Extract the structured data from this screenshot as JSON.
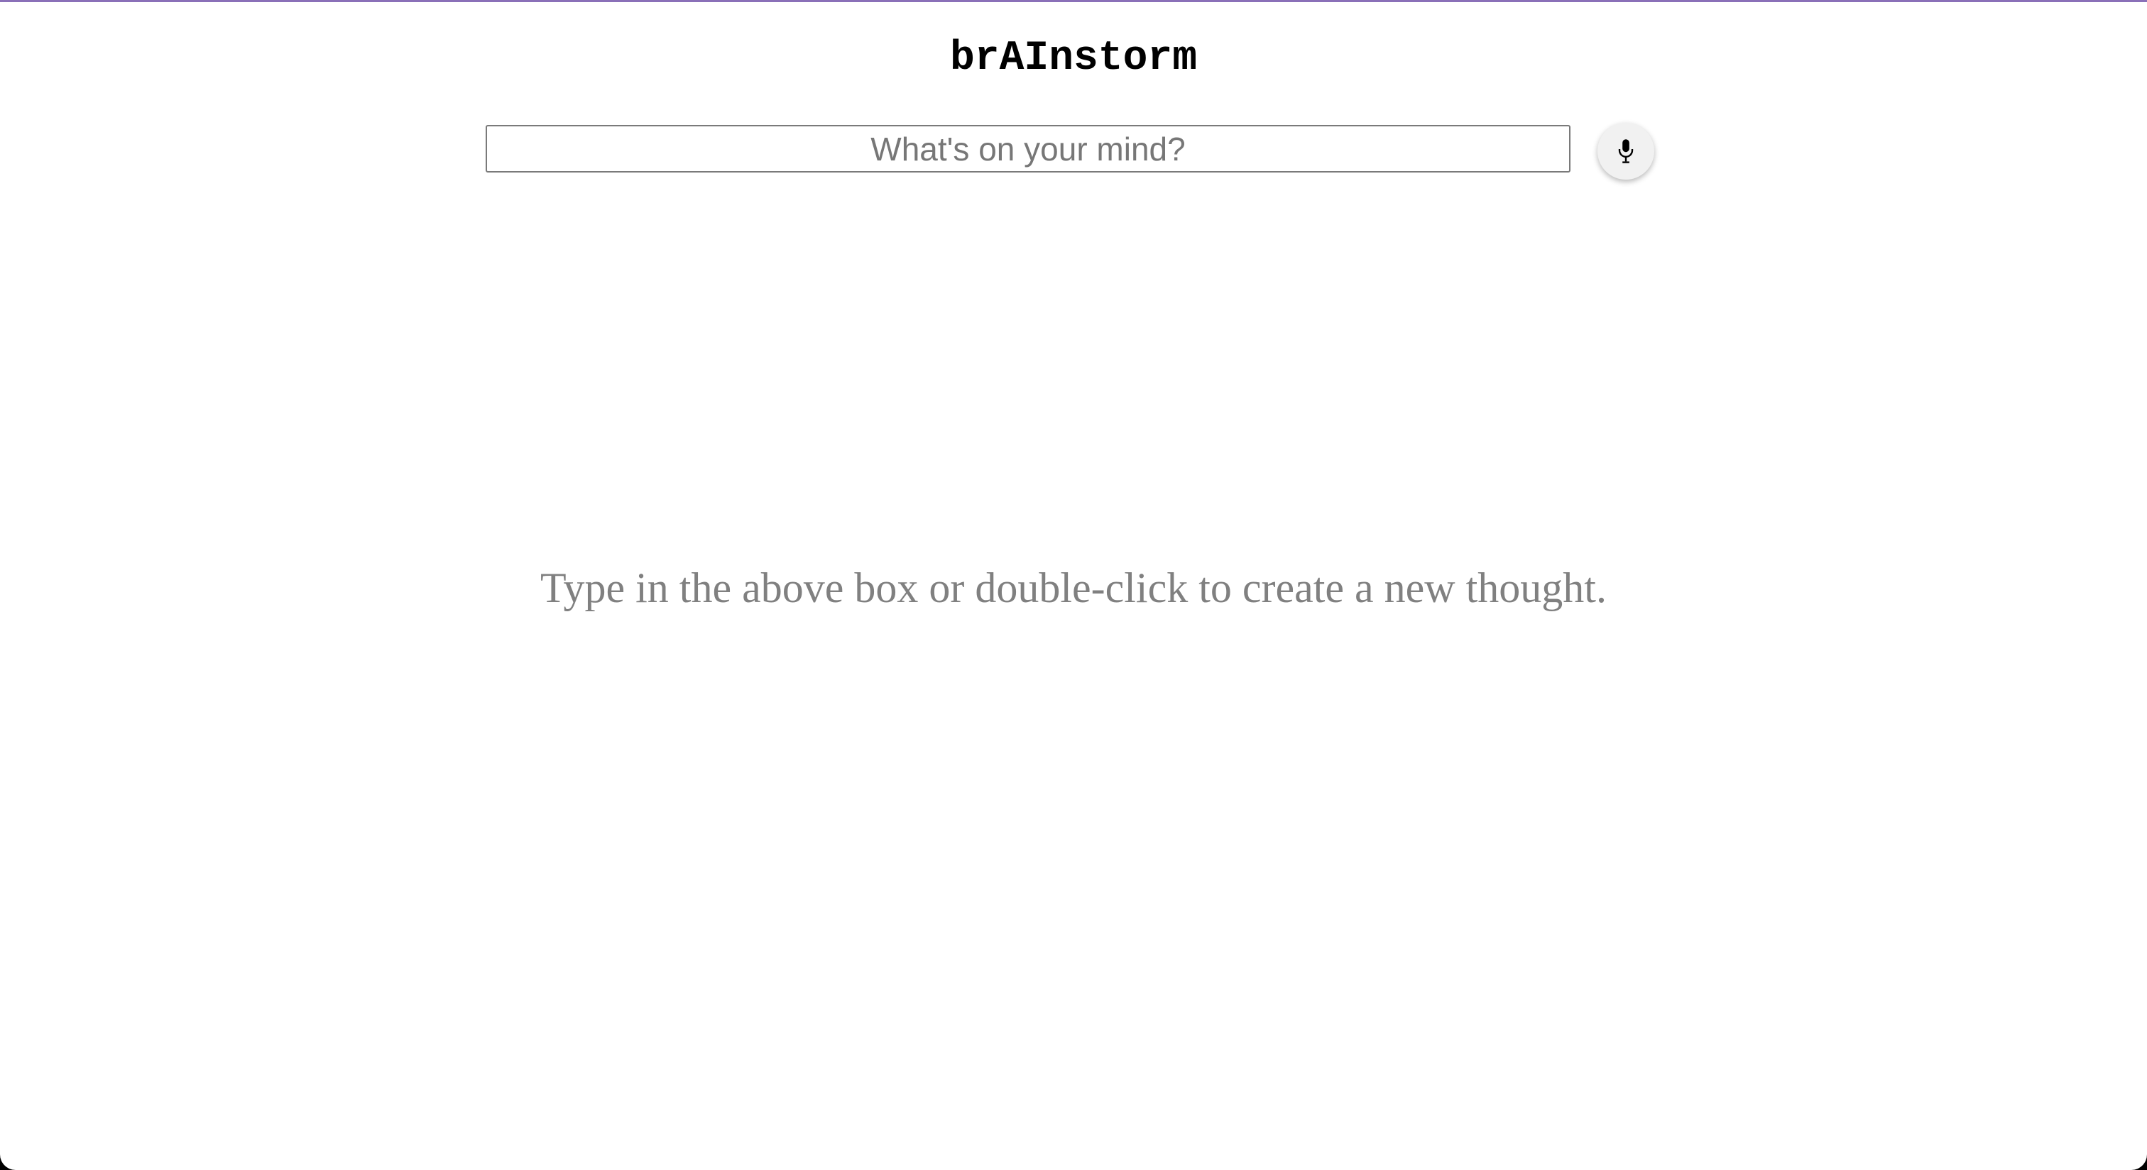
{
  "app": {
    "title": "brAInstorm"
  },
  "search": {
    "placeholder": "What's on your mind?",
    "value": ""
  },
  "voice": {
    "icon": "microphone-icon"
  },
  "canvas": {
    "empty_hint": "Type in the above box or double-click to create a new thought."
  },
  "colors": {
    "window_top_border": "#8a70b8",
    "hint_text": "#808080",
    "mic_button_bg": "#f1f1f1"
  }
}
